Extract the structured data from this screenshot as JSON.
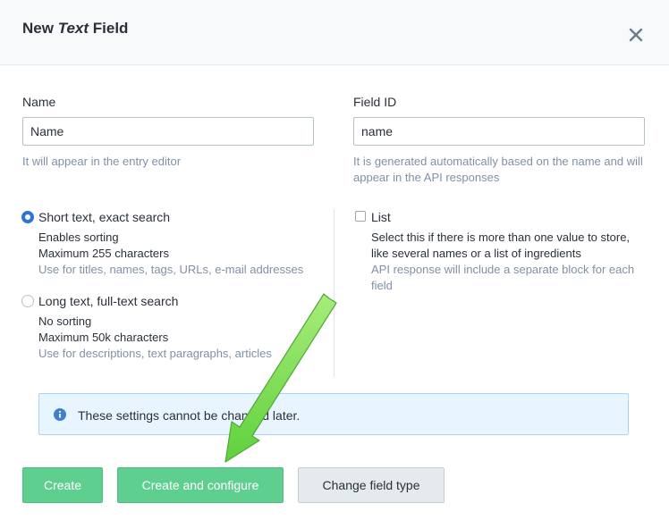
{
  "modal": {
    "title_prefix": "New",
    "title_emphasis": "Text",
    "title_suffix": "Field",
    "close_icon": "close-icon"
  },
  "name_field": {
    "label": "Name",
    "value": "Name",
    "help": "It will appear in the entry editor"
  },
  "field_id": {
    "label": "Field ID",
    "value": "name",
    "help_line1": "It is generated automatically based on the name and will",
    "help_line2": "appear in the API responses"
  },
  "type_options": [
    {
      "title": "Short text, exact search",
      "checked": true,
      "lines": [
        "Enables sorting",
        "Maximum 255 characters"
      ],
      "note": "Use for titles, names, tags, URLs, e-mail addresses"
    },
    {
      "title": "Long text, full-text search",
      "checked": false,
      "lines": [
        "No sorting",
        "Maximum 50k characters"
      ],
      "note": "Use for descriptions, text paragraphs, articles"
    }
  ],
  "list_option": {
    "title": "List",
    "checked": false,
    "lines": [
      "Select this if there is more than one value to store,",
      "like several names or a list of ingredients"
    ],
    "notes": [
      "API response will include a separate block for each",
      "field"
    ]
  },
  "notice": {
    "icon": "info-icon",
    "text": "These settings cannot be changed later."
  },
  "buttons": {
    "create": "Create",
    "create_configure": "Create and configure",
    "change_type": "Change field type"
  },
  "colors": {
    "primary_green": "#5fcf8f",
    "radio_blue": "#2e75d4",
    "notice_bg": "#e8f5ff",
    "annotation_arrow": "#7ed957"
  }
}
